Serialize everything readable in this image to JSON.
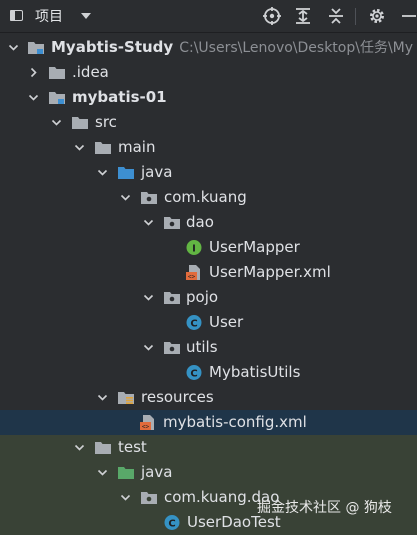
{
  "toolbar": {
    "title": "项目",
    "icons": [
      "project-view-icon",
      "dropdown-caret-icon",
      "locate-icon",
      "expand-all-icon",
      "collapse-all-icon",
      "settings-gear-icon",
      "minimize-icon"
    ]
  },
  "tree": [
    {
      "label": "Myabtis-Study",
      "path": "C:\\Users\\Lenovo\\Desktop\\任务\\My",
      "icon": "module-folder",
      "expanded": true
    },
    {
      "label": ".idea",
      "icon": "folder",
      "expanded": false
    },
    {
      "label": "mybatis-01",
      "icon": "module-folder",
      "expanded": true
    },
    {
      "label": "src",
      "icon": "folder",
      "expanded": true
    },
    {
      "label": "main",
      "icon": "folder",
      "expanded": true
    },
    {
      "label": "java",
      "icon": "source-folder",
      "expanded": true
    },
    {
      "label": "com.kuang",
      "icon": "package",
      "expanded": true
    },
    {
      "label": "dao",
      "icon": "package",
      "expanded": true
    },
    {
      "label": "UserMapper",
      "icon": "interface"
    },
    {
      "label": "UserMapper.xml",
      "icon": "xml-file"
    },
    {
      "label": "pojo",
      "icon": "package",
      "expanded": true
    },
    {
      "label": "User",
      "icon": "class"
    },
    {
      "label": "utils",
      "icon": "package",
      "expanded": true
    },
    {
      "label": "MybatisUtils",
      "icon": "class"
    },
    {
      "label": "resources",
      "icon": "resources-folder",
      "expanded": true
    },
    {
      "label": "mybatis-config.xml",
      "icon": "xml-file",
      "selected": true
    },
    {
      "label": "test",
      "icon": "folder",
      "expanded": true
    },
    {
      "label": "java",
      "icon": "test-source-folder",
      "expanded": true
    },
    {
      "label": "com.kuang.dao",
      "icon": "package",
      "expanded": true
    },
    {
      "label": "UserDaoTest",
      "icon": "class"
    }
  ],
  "watermark": "掘金技术社区 @ 狗枝",
  "colors": {
    "background": "#2b2d30",
    "selected_row": "#1f3549",
    "test_row": "#394236",
    "folder": "#a8adb3",
    "source_folder": "#3d8fd1",
    "test_folder": "#59a869",
    "class_icon": "#3592c4",
    "interface_icon": "#62b543",
    "xml_icon": "#e16b3c"
  }
}
